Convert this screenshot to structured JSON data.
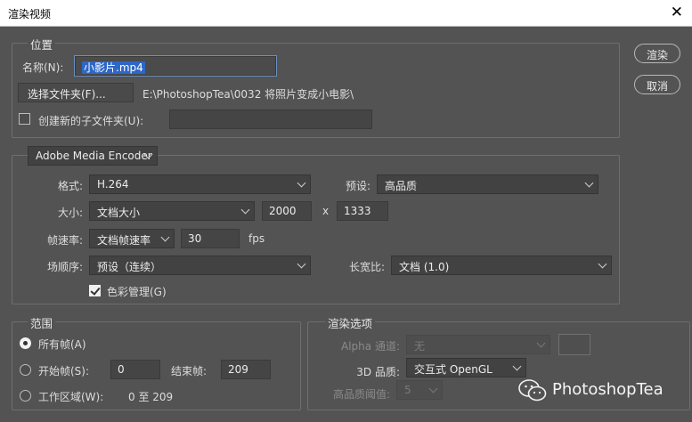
{
  "window": {
    "title": "渲染视频",
    "close_glyph": "✕"
  },
  "buttons": {
    "render": "渲染",
    "cancel": "取消"
  },
  "location": {
    "legend": "位置",
    "name_label": "名称(N):",
    "name_value": "小影片.mp4",
    "choose_folder": "选择文件夹(F)...",
    "folder_path": "E:\\PhotoshopTea\\0032 将照片变成小电影\\",
    "subfolder_label": "创建新的子文件夹(U):",
    "subfolder_checked": false,
    "subfolder_value": ""
  },
  "encoder": {
    "selected": "Adobe Media Encoder",
    "format_label": "格式:",
    "format_value": "H.264",
    "preset_label": "预设:",
    "preset_value": "高品质",
    "size_label": "大小:",
    "size_value": "文档大小",
    "width": "2000",
    "x_sep": "x",
    "height": "1333",
    "framerate_label": "帧速率:",
    "framerate_value": "文档帧速率",
    "fps_value": "30",
    "fps_unit": "fps",
    "field_order_label": "场顺序:",
    "field_order_value": "预设（连续）",
    "aspect_label": "长宽比:",
    "aspect_value": "文档 (1.0)",
    "color_mgmt_label": "色彩管理(G)",
    "color_mgmt_checked": true
  },
  "range": {
    "legend": "范围",
    "all_frames": "所有帧(A)",
    "start_frame_label": "开始帧(S):",
    "start_frame_value": "0",
    "end_frame_label": "结束帧:",
    "end_frame_value": "209",
    "work_area_label": "工作区域(W):",
    "work_area_value": "0 至 209",
    "selected": "all_frames"
  },
  "render_options": {
    "legend": "渲染选项",
    "alpha_label": "Alpha 通道:",
    "alpha_value": "无",
    "quality_label": "3D 品质:",
    "quality_value": "交互式 OpenGL",
    "threshold_label": "高品质阈值:",
    "threshold_value": "5"
  },
  "watermark": {
    "text": "PhotoshopTea",
    "icon": "wechat-icon"
  }
}
